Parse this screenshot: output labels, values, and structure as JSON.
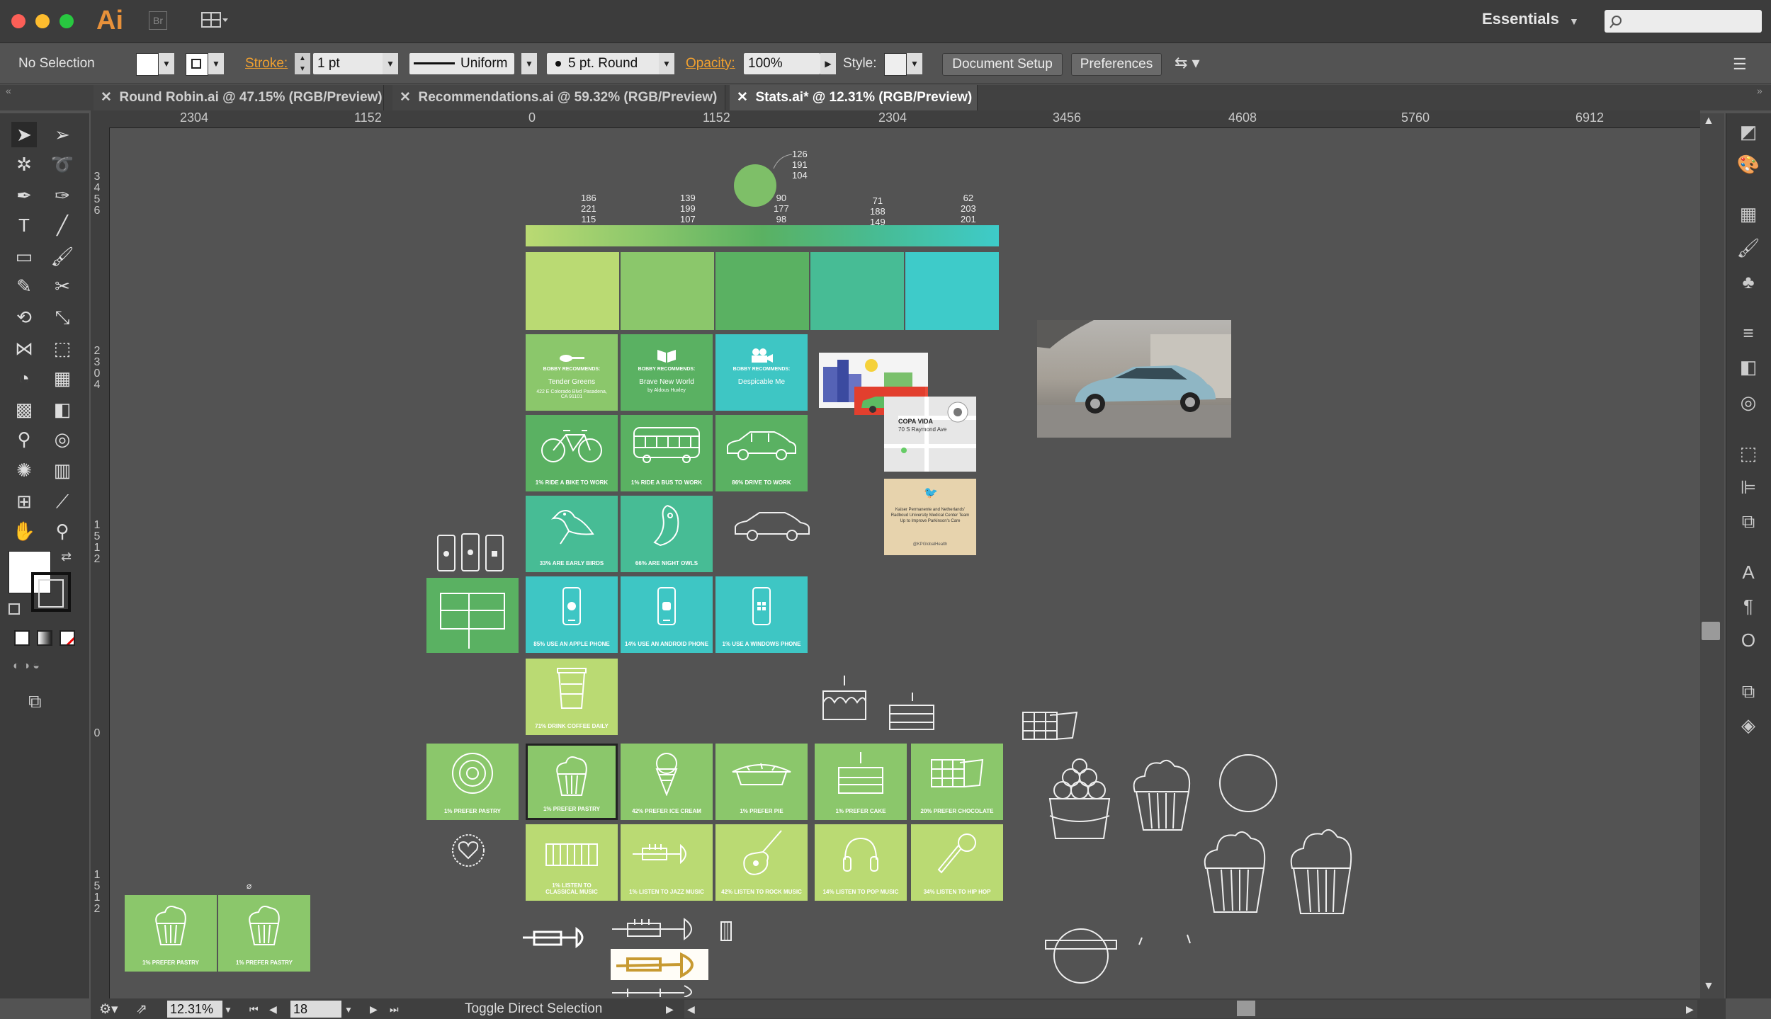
{
  "app": {
    "logo": "Ai",
    "bridge": "Br",
    "workspace": "Essentials"
  },
  "control": {
    "selection": "No Selection",
    "stroke_label": "Stroke:",
    "stroke_value": "1 pt",
    "profile": "Uniform",
    "brush": "5 pt. Round",
    "opacity_label": "Opacity:",
    "opacity_value": "100%",
    "style_label": "Style:",
    "doc_setup": "Document Setup",
    "preferences": "Preferences"
  },
  "tabs": [
    {
      "label": "Round Robin.ai @ 47.15% (RGB/Preview)"
    },
    {
      "label": "Recommendations.ai @ 59.32% (RGB/Preview)"
    },
    {
      "label": "Stats.ai* @ 12.31% (RGB/Preview)"
    }
  ],
  "ruler": {
    "h": [
      "2304",
      "1152",
      "0",
      "1152",
      "2304",
      "3456",
      "4608",
      "5760",
      "6912"
    ],
    "v": [
      "3\n4\n5\n6",
      "2\n3\n0\n4",
      "1\n5\n1\n2",
      "0",
      "1\n5\n1\n2"
    ]
  },
  "status": {
    "zoom": "12.31%",
    "page": "18",
    "tool": "Toggle Direct Selection"
  },
  "colors": {
    "accent": "#f0a030",
    "lime": "#b8dc78",
    "green": "#88c96e",
    "mid": "#5bb470",
    "teal": "#3fb7a0",
    "cyan": "#3fc6c8"
  },
  "art": {
    "rgb": [
      {
        "v": "186\n221\n115"
      },
      {
        "v": "139\n199\n107"
      },
      {
        "v": "90\n177\n98"
      },
      {
        "v": "71\n188\n149"
      },
      {
        "v": "62\n203\n201"
      },
      {
        "v": "126\n191\n104"
      }
    ],
    "recs": [
      {
        "head": "BOBBY RECOMMENDS:",
        "title": "Tender Greens",
        "sub": "422 E Colorado Blvd Pasadena, CA 91101"
      },
      {
        "head": "BOBBY RECOMMENDS:",
        "title": "Brave New World",
        "sub": "by Aldous Huxley"
      },
      {
        "head": "BOBBY RECOMMENDS:",
        "title": "Despicable Me",
        "sub": ""
      }
    ],
    "transport": [
      "1% RIDE A BIKE TO WORK",
      "1% RIDE A BUS TO WORK",
      "86% DRIVE TO WORK"
    ],
    "birds": [
      "33% ARE EARLY BIRDS",
      "66% ARE NIGHT OWLS"
    ],
    "phones": [
      "85% USE AN APPLE PHONE",
      "14% USE AN ANDROID PHONE",
      "1% USE A WINDOWS PHONE"
    ],
    "coffee": "71% DRINK COFFEE DAILY",
    "desserts": [
      "1% PREFER PASTRY",
      "1% PREFER PASTRY",
      "42% PREFER ICE CREAM",
      "1% PREFER PIE",
      "1% PREFER CAKE",
      "20% PREFER CHOCOLATE"
    ],
    "music": [
      "1% LISTEN TO CLASSICAL MUSIC",
      "1% LISTEN TO JAZZ MUSIC",
      "42% LISTEN TO ROCK MUSIC",
      "14% LISTEN TO POP MUSIC",
      "34% LISTEN TO HIP HOP"
    ],
    "bottom": [
      "1% PREFER PASTRY",
      "1% PREFER PASTRY"
    ],
    "map_title": "COPA VIDA",
    "map_addr": "70 S Raymond Ave",
    "tweet": "Kaiser Permanente and Netherlands' Radboud University Medical Center Team Up to Improve Parkinson's Care",
    "tweet_handle": "@KPGlobalHealth"
  }
}
